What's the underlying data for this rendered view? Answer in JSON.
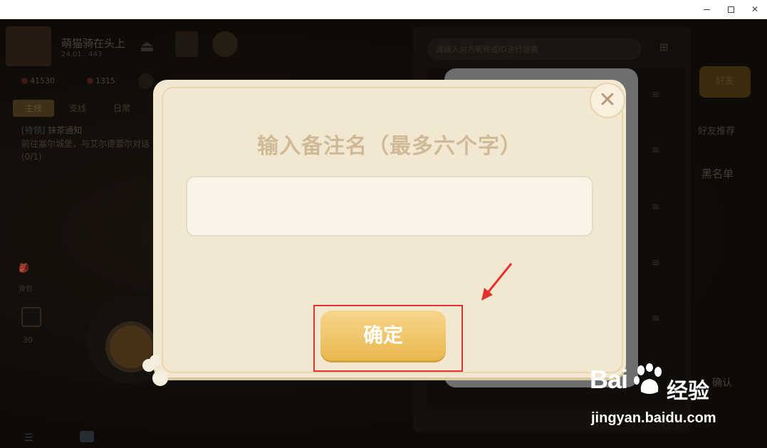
{
  "window": {
    "minimize_icon": "minimize-icon",
    "maximize_icon": "maximize-icon",
    "close_icon": "close-icon"
  },
  "hud": {
    "player_name": "萌猫骑在头上",
    "player_sub": "24.01 . 443",
    "resource_1": "41530",
    "resource_2": "1315",
    "tabs": [
      "主线",
      "支线",
      "日常"
    ],
    "quest_tag": "[待领]",
    "quest_title": "抹茶通知",
    "quest_desc": "前往塞尔城堡，与艾尔德蕾尔对话 (0/1)",
    "side_label_1": "背包",
    "side_label_2": "30"
  },
  "right_panel": {
    "search_placeholder": "请输入对方昵称或ID进行搜索",
    "button_1": "好友",
    "label_2": "好友推荐",
    "label_3": "黑名单",
    "label_4": "确认"
  },
  "modal": {
    "title": "输入备注名（最多六个字）",
    "input_value": "",
    "input_placeholder": "",
    "confirm_label": "确定",
    "close_glyph": "✕"
  },
  "annotation": {
    "highlight_color": "#e53030"
  },
  "watermark": {
    "brand_left": "Bai",
    "brand_right": "经验",
    "url": "jingyan.baidu.com"
  },
  "colors": {
    "modal_bg": "#f2e8d2",
    "confirm_button": "#f0c86a",
    "title_text": "#cfba98"
  }
}
